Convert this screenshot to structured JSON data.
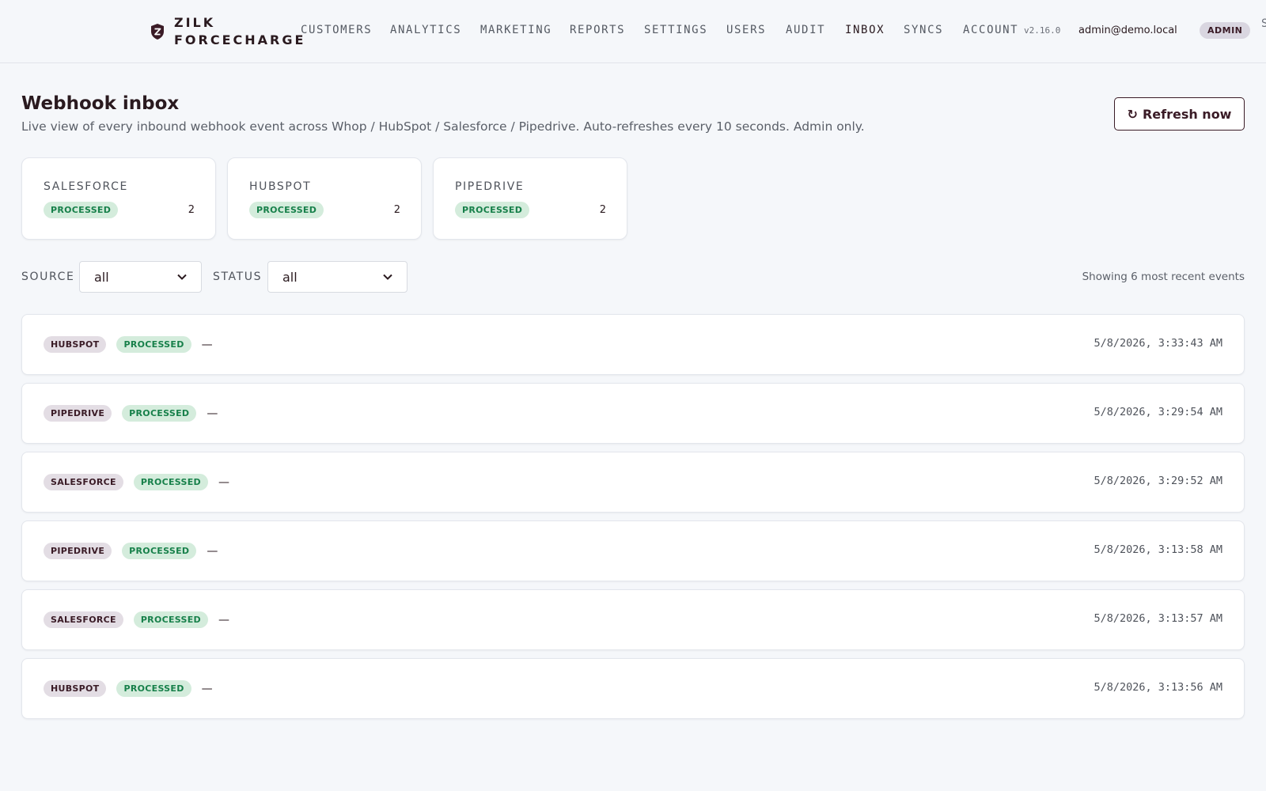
{
  "brand": {
    "line1": "ZILK",
    "line2": "FORCECHARGE",
    "logo_icon": "shield-z-icon",
    "color": "#3a1b26"
  },
  "nav": {
    "items": [
      {
        "label": "CUSTOMERS",
        "active": false
      },
      {
        "label": "ANALYTICS",
        "active": false
      },
      {
        "label": "MARKETING",
        "active": false
      },
      {
        "label": "REPORTS",
        "active": false
      },
      {
        "label": "SETTINGS",
        "active": false
      },
      {
        "label": "USERS",
        "active": false
      },
      {
        "label": "AUDIT",
        "active": false
      },
      {
        "label": "INBOX",
        "active": true
      },
      {
        "label": "SYNCS",
        "active": false
      },
      {
        "label": "ACCOUNT",
        "active": false
      }
    ],
    "version": "v2.16.0",
    "user_email": "admin@demo.local",
    "role": "ADMIN",
    "overflow": "S"
  },
  "header": {
    "title": "Webhook inbox",
    "subtitle": "Live view of every inbound webhook event across Whop / HubSpot / Salesforce / Pipedrive. Auto-refreshes every 10 seconds. Admin only.",
    "refresh_icon": "↻",
    "refresh_label": "Refresh now"
  },
  "summary": [
    {
      "source": "SALESFORCE",
      "status": "PROCESSED",
      "count": "2"
    },
    {
      "source": "HUBSPOT",
      "status": "PROCESSED",
      "count": "2"
    },
    {
      "source": "PIPEDRIVE",
      "status": "PROCESSED",
      "count": "2"
    }
  ],
  "filters": {
    "source_label": "SOURCE",
    "source_value": "all",
    "status_label": "STATUS",
    "status_value": "all",
    "showing": "Showing 6 most recent events"
  },
  "events": [
    {
      "source": "HUBSPOT",
      "status": "PROCESSED",
      "detail": "—",
      "time": "5/8/2026, 3:33:43 AM"
    },
    {
      "source": "PIPEDRIVE",
      "status": "PROCESSED",
      "detail": "—",
      "time": "5/8/2026, 3:29:54 AM"
    },
    {
      "source": "SALESFORCE",
      "status": "PROCESSED",
      "detail": "—",
      "time": "5/8/2026, 3:29:52 AM"
    },
    {
      "source": "PIPEDRIVE",
      "status": "PROCESSED",
      "detail": "—",
      "time": "5/8/2026, 3:13:58 AM"
    },
    {
      "source": "SALESFORCE",
      "status": "PROCESSED",
      "detail": "—",
      "time": "5/8/2026, 3:13:57 AM"
    },
    {
      "source": "HUBSPOT",
      "status": "PROCESSED",
      "detail": "—",
      "time": "5/8/2026, 3:13:56 AM"
    }
  ],
  "colors": {
    "accent": "#3a1b26",
    "processed_bg": "#d4ecdc",
    "processed_text": "#17804a",
    "source_bg": "#e3dde4",
    "page_bg": "#f5f7fa"
  }
}
